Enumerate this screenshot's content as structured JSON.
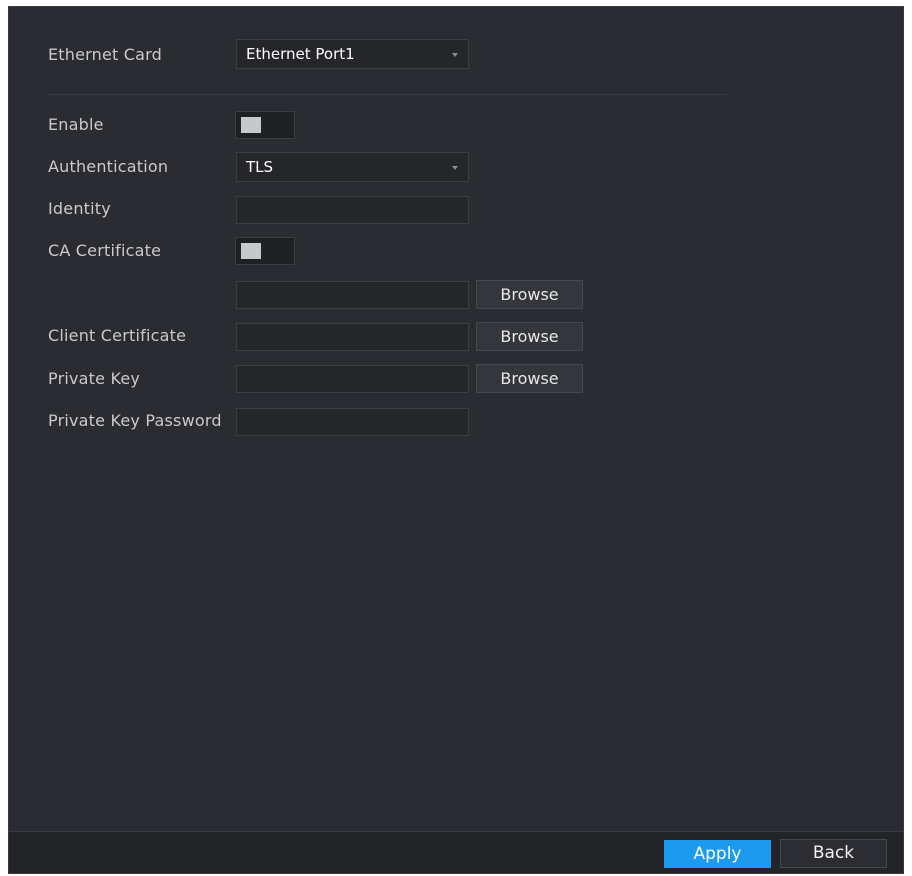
{
  "form": {
    "ethernet_card": {
      "label": "Ethernet Card",
      "value": "Ethernet Port1"
    },
    "enable": {
      "label": "Enable",
      "state": "off"
    },
    "authentication": {
      "label": "Authentication",
      "value": "TLS"
    },
    "identity": {
      "label": "Identity",
      "value": ""
    },
    "ca_certificate": {
      "label": "CA Certificate",
      "state": "off",
      "file_value": "",
      "browse_label": "Browse"
    },
    "client_certificate": {
      "label": "Client Certificate",
      "file_value": "",
      "browse_label": "Browse"
    },
    "private_key": {
      "label": "Private Key",
      "file_value": "",
      "browse_label": "Browse"
    },
    "private_key_password": {
      "label": "Private Key Password",
      "value": ""
    }
  },
  "footer": {
    "apply_label": "Apply",
    "back_label": "Back"
  },
  "icons": {
    "dropdown": "chevron-down-icon"
  },
  "colors": {
    "panel_bg": "#2b2c31",
    "accent": "#1b9aef"
  }
}
